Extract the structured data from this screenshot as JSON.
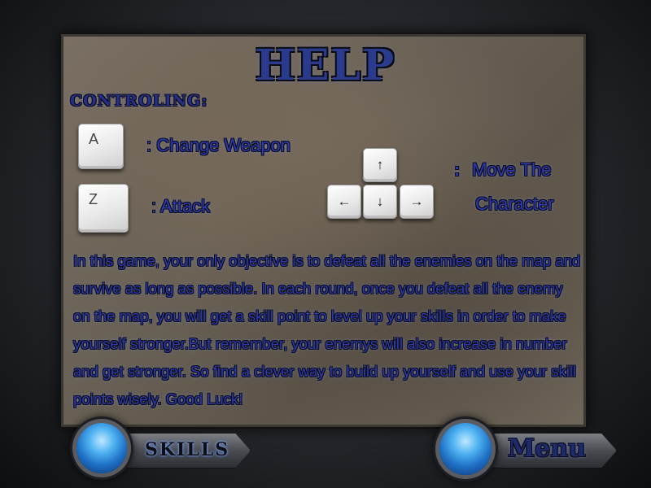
{
  "title": "HELP",
  "controls": {
    "section_label": "CONTROLING:",
    "key_a": "A",
    "key_a_desc": ": Change Weapon",
    "key_z": "Z",
    "key_z_desc": ": Attack",
    "arrows": {
      "up": "↑",
      "left": "←",
      "down": "↓",
      "right": "→"
    },
    "arrows_desc_colon": ":",
    "arrows_desc_line1": "Move The",
    "arrows_desc_line2": "Character"
  },
  "description": "In this game, your only objective is to defeat all the enemies on the map and survive as long as possible. In each round, once you defeat all the enemy on the map, you will get a skill point to level up your skills in order to make yourself stronger.But remember, your enemys will also increase in number and get stronger. So find a clever way to build up yourself and use your skill points wisely. Good Luck!",
  "buttons": {
    "skills_label": "SKILLS",
    "menu_label": "Menu"
  }
}
